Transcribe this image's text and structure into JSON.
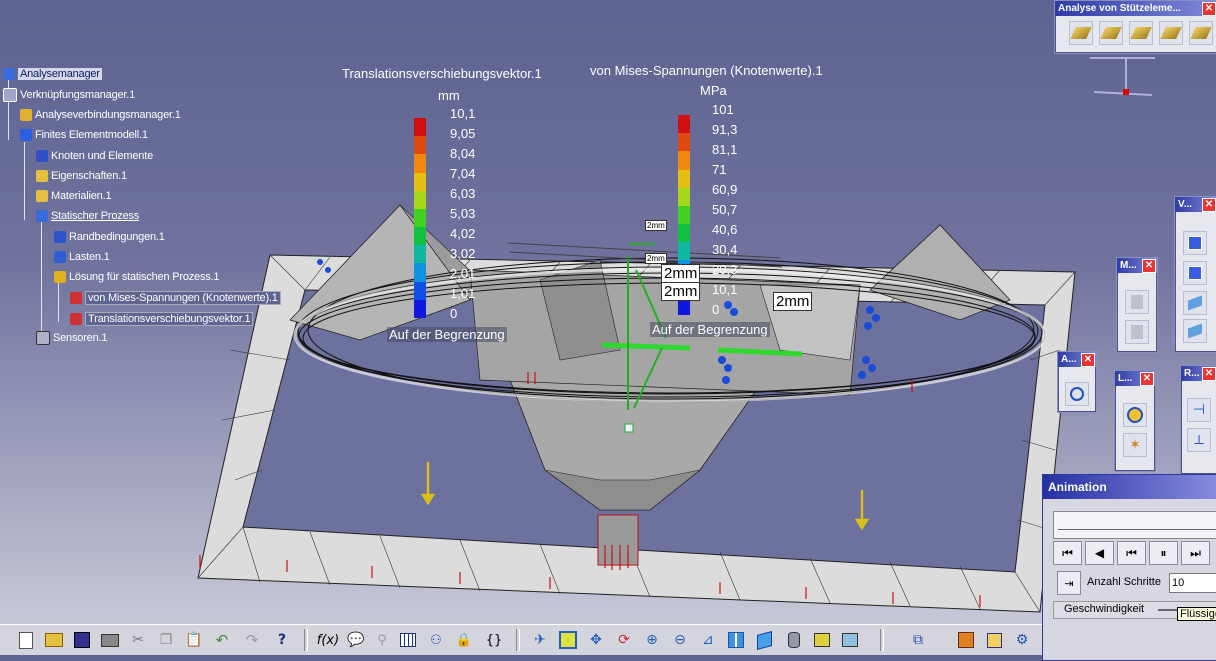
{
  "tree": {
    "items": [
      {
        "label": "Analysemanager"
      },
      {
        "label": "Verknüpfungsmanager.1"
      },
      {
        "label": "Analyseverbindungsmanager.1"
      },
      {
        "label": "Finites Elementmodell.1"
      },
      {
        "label": "Knoten und Elemente"
      },
      {
        "label": "Eigenschaften.1"
      },
      {
        "label": "Materialien.1"
      },
      {
        "label": "Statischer Prozess"
      },
      {
        "label": "Randbedingungen.1"
      },
      {
        "label": "Lasten.1"
      },
      {
        "label": "Lösung für statischen Prozess.1"
      },
      {
        "label": "von Mises-Spannungen (Knotenwerte).1"
      },
      {
        "label": "Translationsverschiebungsvektor.1"
      },
      {
        "label": "Sensoren.1"
      }
    ]
  },
  "legend_displacement": {
    "title": "Translationsverschiebungsvektor.1",
    "unit": "mm",
    "values": [
      "10,1",
      "9,05",
      "8,04",
      "7,04",
      "6,03",
      "5,03",
      "4,02",
      "3,02",
      "2,01",
      "1,01",
      "0"
    ],
    "footer": "Auf der Begrenzung"
  },
  "legend_stress": {
    "title": "von Mises-Spannungen (Knotenwerte).1",
    "unit": "MPa",
    "values": [
      "101",
      "91,3",
      "81,1",
      "71",
      "60,9",
      "50,7",
      "40,6",
      "30,4",
      "20,3",
      "10,1",
      "0"
    ],
    "footer": "Auf der Begrenzung"
  },
  "dimensions": {
    "d1": "2mm",
    "d2": "2mm",
    "d3": "2mm",
    "small1": "2mm",
    "small2": "2mm"
  },
  "toolbar_support": {
    "title": "Analyse von Stützeleme..."
  },
  "toolbar_v": {
    "title": "V..."
  },
  "toolbar_m": {
    "title": "M..."
  },
  "toolbar_a": {
    "title": "A..."
  },
  "toolbar_l": {
    "title": "L..."
  },
  "toolbar_r": {
    "title": "R..."
  },
  "animation": {
    "title": "Animation",
    "steps_label": "Anzahl Schritte",
    "steps_value": "10",
    "speed_label": "Geschwindigkeit",
    "speed_tooltip": "Flüssige"
  },
  "colors": {
    "scale": [
      "#d01010",
      "#e04a10",
      "#ef8a10",
      "#e6c010",
      "#a8d81a",
      "#40d020",
      "#12c040",
      "#10b8a0",
      "#1090e0",
      "#1050e8",
      "#1018e0"
    ]
  }
}
